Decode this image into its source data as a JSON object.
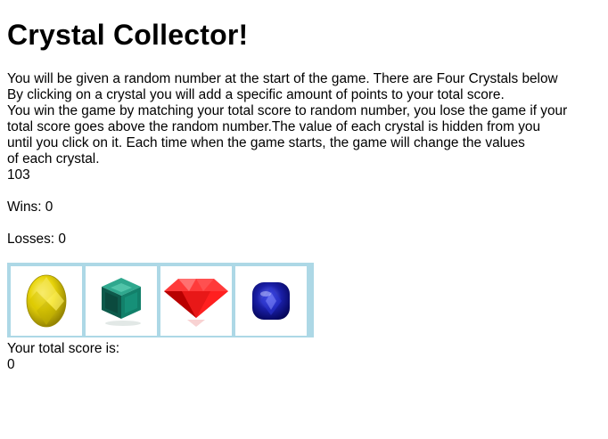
{
  "header": {
    "title": "Crystal Collector!"
  },
  "instructions": {
    "lines": [
      "You will be given a random number at the start of the game. There are Four Crystals below",
      "By clicking on a crystal you will add a specific amount of points to your total score.",
      "You win the game by matching your total score to random number, you lose the game if your",
      "total score goes above the random number.The value of each crystal is hidden from you",
      "until you click on it. Each time when the game starts, the game will change the values",
      "of each crystal."
    ]
  },
  "game": {
    "target_number": "103",
    "wins_text": "Wins: 0",
    "losses_text": "Losses: 0",
    "score_label": "Your total score is:",
    "score_value": "0"
  },
  "crystals": [
    {
      "name": "yellow-crystal",
      "color": "#e8d40a",
      "icon": "yellow-oval-gem-icon"
    },
    {
      "name": "green-crystal",
      "color": "#0f6b5a",
      "icon": "green-cube-gem-icon"
    },
    {
      "name": "red-crystal",
      "color": "#e01010",
      "icon": "red-diamond-gem-icon"
    },
    {
      "name": "blue-crystal",
      "color": "#1a1fa8",
      "icon": "blue-cushion-gem-icon"
    }
  ],
  "colors": {
    "crystal_border": "#add8e6"
  }
}
